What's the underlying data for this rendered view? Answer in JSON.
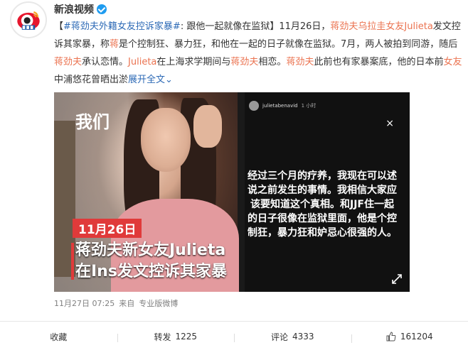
{
  "account": {
    "name": "新浪视频",
    "verified": true
  },
  "post": {
    "segments": [
      {
        "text": "【",
        "style": "plain"
      },
      {
        "text": "#蒋劲夫外籍女友控诉家暴#",
        "style": "link-blue"
      },
      {
        "text": ": 跟他一起就像在监狱】11月26日，",
        "style": "plain"
      },
      {
        "text": "蒋劲夫乌拉圭女友Julieta",
        "style": "link-red"
      },
      {
        "text": "发文控诉其家暴，称",
        "style": "plain"
      },
      {
        "text": "蒋",
        "style": "link-red"
      },
      {
        "text": "是个控制狂、暴力狂，和他在一起的日子就像在监狱。7月，两人被拍到同游，随后",
        "style": "plain"
      },
      {
        "text": "蒋劲夫",
        "style": "link-red"
      },
      {
        "text": "承认恋情。",
        "style": "plain"
      },
      {
        "text": "Julieta",
        "style": "link-red"
      },
      {
        "text": "在上海求学期间与",
        "style": "plain"
      },
      {
        "text": "蒋劲夫",
        "style": "link-red"
      },
      {
        "text": "相恋。",
        "style": "plain"
      },
      {
        "text": "蒋劲夫",
        "style": "link-red"
      },
      {
        "text": "此前也有家暴案底，他的日本前",
        "style": "plain"
      },
      {
        "text": "女友",
        "style": "link-red"
      },
      {
        "text": "中浦悠花曾晒出淤",
        "style": "plain"
      },
      {
        "text": "展开全文",
        "style": "link-blue"
      },
      {
        "text": "⌄",
        "style": "link-blue"
      }
    ]
  },
  "media": {
    "logo": "我们",
    "date_tag": "11月26日",
    "caption_line1": "蒋劲夫新女友Julieta",
    "caption_line2": "在Ins发文控诉其家暴",
    "story_user": "julietabenavid",
    "story_time": "1 小时",
    "story_text": "经过三个月的疗养，我现在可以述说之前发生的事情。我相信大家应该要知道这个真相。和JJF住一起的日子很像在监狱里面，他是个控制狂，暴力狂和妒忌心很强的人。",
    "close_icon": "×"
  },
  "meta": {
    "time": "11月27日 07:25",
    "from": "来自",
    "source": "专业版微博"
  },
  "actions": {
    "favorite": "收藏",
    "repost_label": "转发",
    "repost_count": "1225",
    "comment_label": "评论",
    "comment_count": "4333",
    "like_count": "161204"
  },
  "colors": {
    "link_red": "#eb7350",
    "link_blue": "#2d6ab6",
    "verify": "#1f9cf0"
  }
}
